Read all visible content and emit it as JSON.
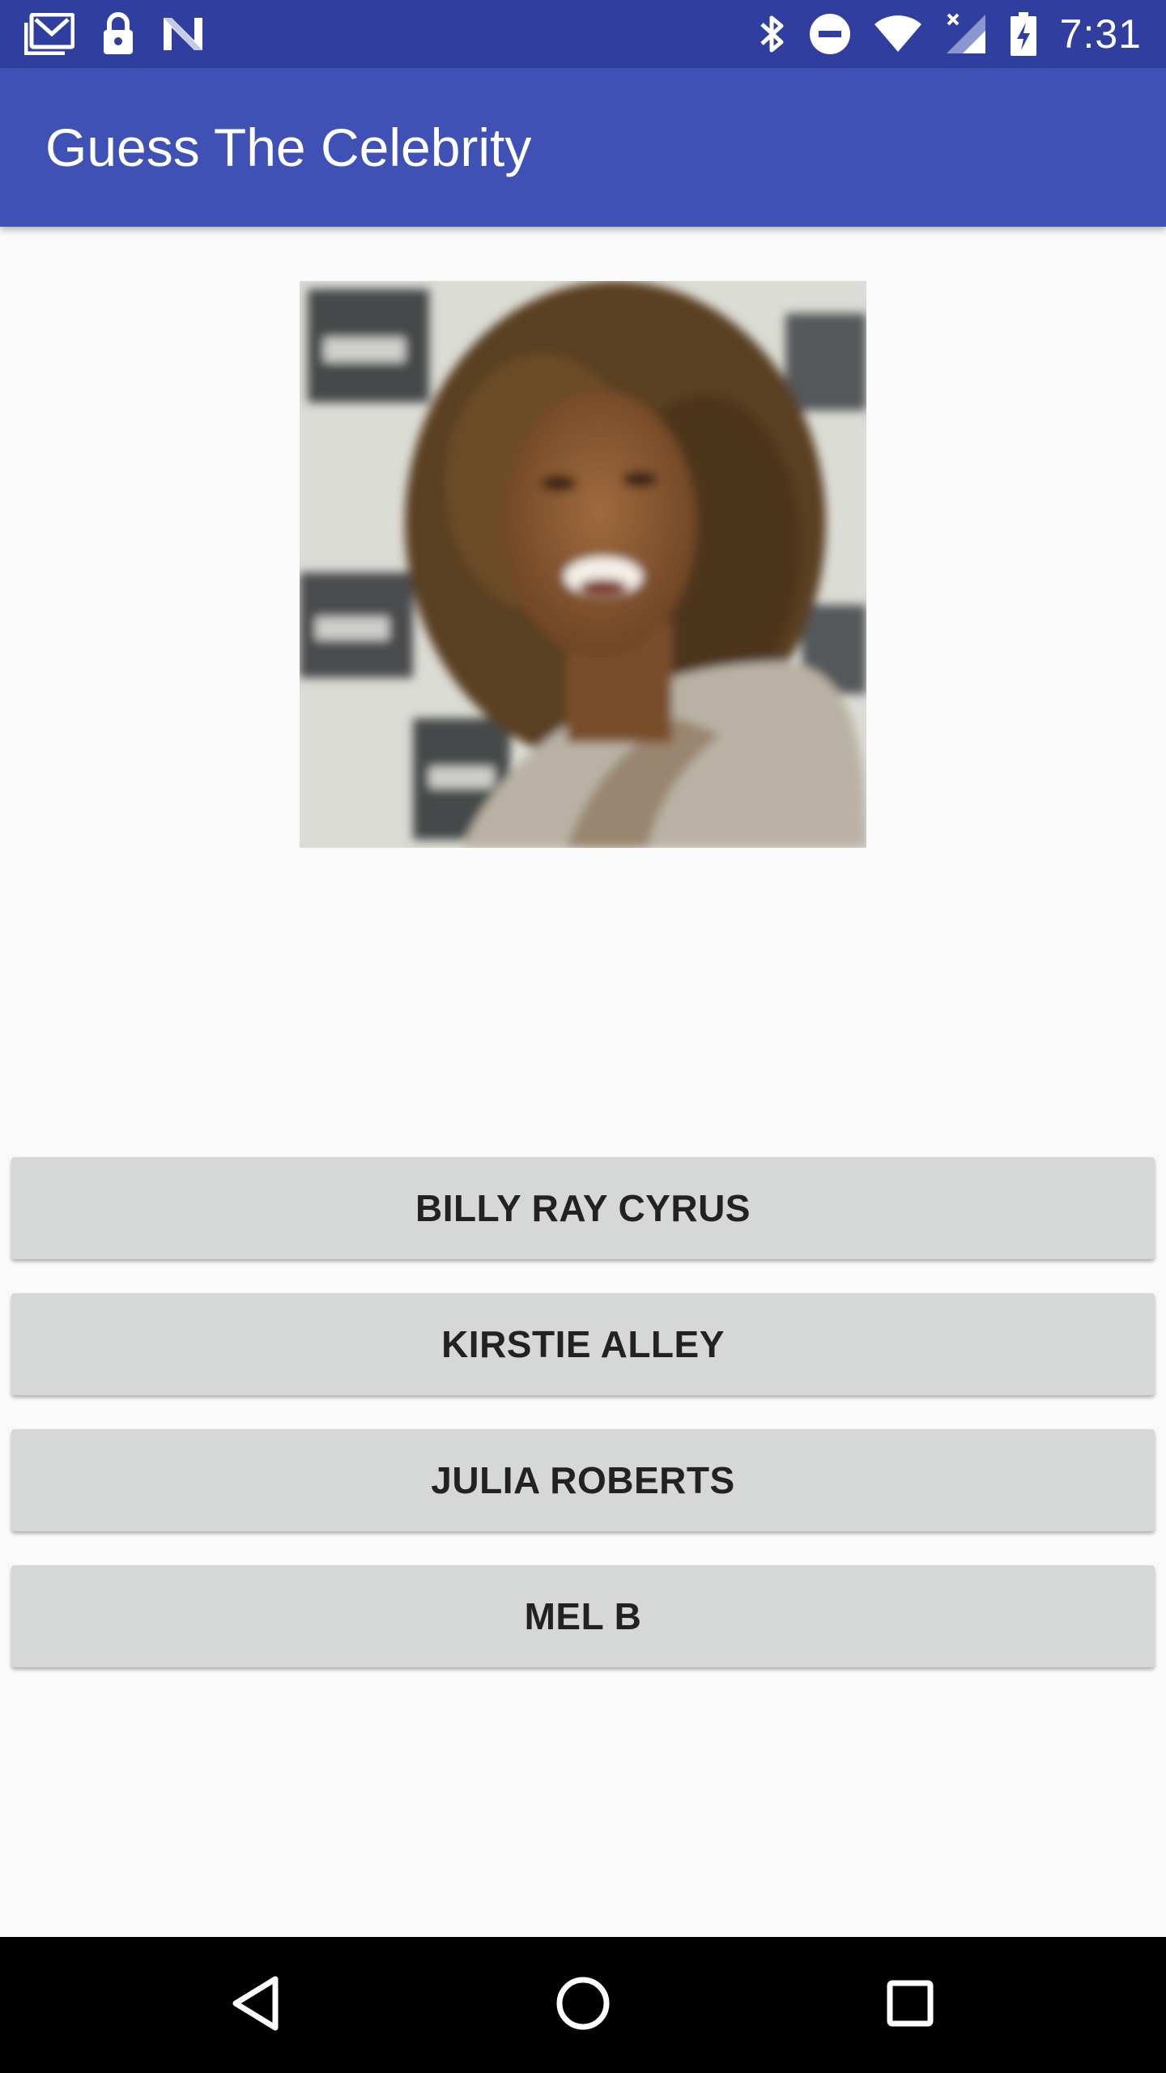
{
  "status_bar": {
    "time": "7:31",
    "left_icons": [
      "gmail-icon",
      "lock-icon",
      "n-logo-icon"
    ],
    "right_icons": [
      "bluetooth-icon",
      "do-not-disturb-icon",
      "wifi-icon",
      "signal-icon",
      "battery-charging-icon"
    ]
  },
  "app_bar": {
    "title": "Guess The Celebrity"
  },
  "main": {
    "celebrity_image": "celebrity-photo",
    "answers": [
      {
        "label": "BILLY RAY CYRUS"
      },
      {
        "label": "KIRSTIE ALLEY"
      },
      {
        "label": "JULIA ROBERTS"
      },
      {
        "label": "MEL B"
      }
    ]
  },
  "nav_bar": {
    "buttons": [
      "back-icon",
      "home-icon",
      "recents-icon"
    ]
  },
  "colors": {
    "status_bar": "#303f9f",
    "app_bar": "#3f51b5",
    "background": "#fafafa",
    "button": "#d6d7d7",
    "nav_bar": "#000000"
  }
}
